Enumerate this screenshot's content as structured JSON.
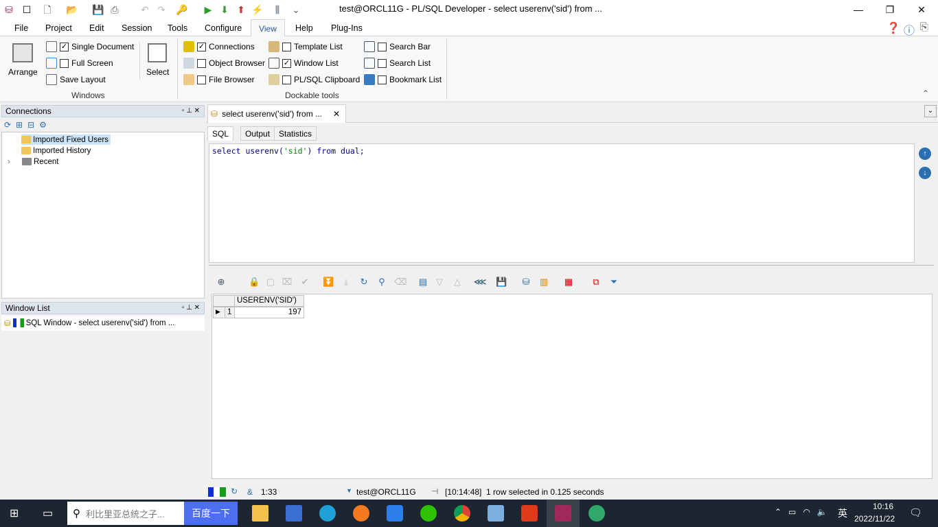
{
  "window": {
    "title": "test@ORCL11G - PL/SQL Developer - select userenv('sid') from ...",
    "minimize": "—",
    "restore": "❐",
    "close": "✕"
  },
  "menu": [
    "File",
    "Project",
    "Edit",
    "Session",
    "Tools",
    "Configure",
    "View",
    "Help",
    "Plug-Ins"
  ],
  "ribbon": {
    "windows_group": "Windows",
    "dockable_group": "Dockable tools",
    "arrange": "Arrange",
    "select": "Select",
    "single_document": {
      "label": "Single Document",
      "checked": true
    },
    "full_screen": {
      "label": "Full Screen",
      "checked": false
    },
    "save_layout": "Save Layout",
    "connections": {
      "label": "Connections",
      "checked": true
    },
    "object_browser": {
      "label": "Object Browser",
      "checked": false
    },
    "file_browser": {
      "label": "File Browser",
      "checked": false
    },
    "template_list": {
      "label": "Template List",
      "checked": false
    },
    "window_list": {
      "label": "Window List",
      "checked": true
    },
    "plsql_clipboard": {
      "label": "PL/SQL Clipboard",
      "checked": false
    },
    "search_bar": {
      "label": "Search Bar",
      "checked": false
    },
    "search_list": {
      "label": "Search List",
      "checked": false
    },
    "bookmark_list": {
      "label": "Bookmark List",
      "checked": false
    }
  },
  "connections": {
    "title": "Connections",
    "items": [
      "Imported Fixed Users",
      "Imported History",
      "Recent"
    ]
  },
  "window_list": {
    "title": "Window List",
    "items": [
      "SQL Window - select userenv('sid') from ..."
    ]
  },
  "editor": {
    "tab": "select userenv('sid') from ...",
    "subtabs": [
      "SQL",
      "Output",
      "Statistics"
    ],
    "sql": {
      "kw1": "select",
      "fn": "userenv(",
      "str": "'sid'",
      "rest": ")",
      "kw2": "from",
      "tbl": "dual;"
    }
  },
  "results": {
    "columns": [
      "USERENV('SID')"
    ],
    "rows": [
      [
        "1",
        "197"
      ]
    ]
  },
  "status": {
    "position": "1:33",
    "connection": "test@ORCL11G",
    "message": "[10:14:48]  1 row selected in 0.125 seconds"
  },
  "taskbar": {
    "search_placeholder": "利比里亚总统之子...",
    "search_button": "百度一下",
    "time": "10:16",
    "date": "2022/11/22",
    "ime": "英"
  }
}
